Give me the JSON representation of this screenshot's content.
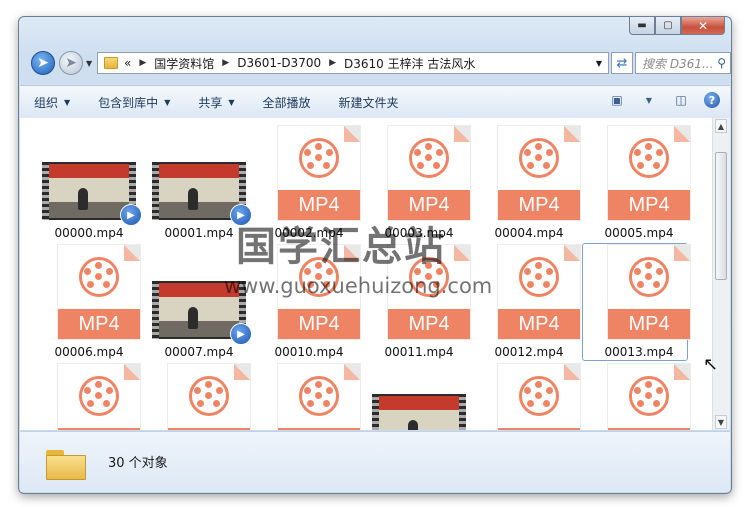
{
  "window": {
    "caption_buttons": {
      "minimize_icon": "minimize-icon",
      "maximize_icon": "maximize-icon",
      "close_icon": "close-icon"
    }
  },
  "nav": {
    "breadcrumb_overflow": "«",
    "breadcrumbs": [
      "国学资料馆",
      "D3601-D3700",
      "D3610 王梓沣 古法风水"
    ],
    "search_placeholder": "搜索 D361..."
  },
  "toolbar": {
    "organize": "组织",
    "include_library": "包含到库中",
    "share": "共享",
    "play_all": "全部播放",
    "new_folder": "新建文件夹"
  },
  "files": [
    {
      "name": "00000.mp4",
      "kind": "video"
    },
    {
      "name": "00001.mp4",
      "kind": "video"
    },
    {
      "name": "00002.mp4",
      "kind": "mp4"
    },
    {
      "name": "00003.mp4",
      "kind": "mp4"
    },
    {
      "name": "00004.mp4",
      "kind": "mp4"
    },
    {
      "name": "00005.mp4",
      "kind": "mp4"
    },
    {
      "name": "00006.mp4",
      "kind": "mp4"
    },
    {
      "name": "00007.mp4",
      "kind": "video"
    },
    {
      "name": "00010.mp4",
      "kind": "mp4"
    },
    {
      "name": "00011.mp4",
      "kind": "mp4"
    },
    {
      "name": "00012.mp4",
      "kind": "mp4"
    },
    {
      "name": "00013.mp4",
      "kind": "mp4",
      "selected": true
    }
  ],
  "file_badge_text": "MP4",
  "details": {
    "count": "30 个对象"
  },
  "watermark": {
    "title": "国学汇总站",
    "url": "www.guoxuehuizong.com"
  },
  "colors": {
    "mp4_accent": "#ee8463",
    "selection": "#7da2ce"
  }
}
